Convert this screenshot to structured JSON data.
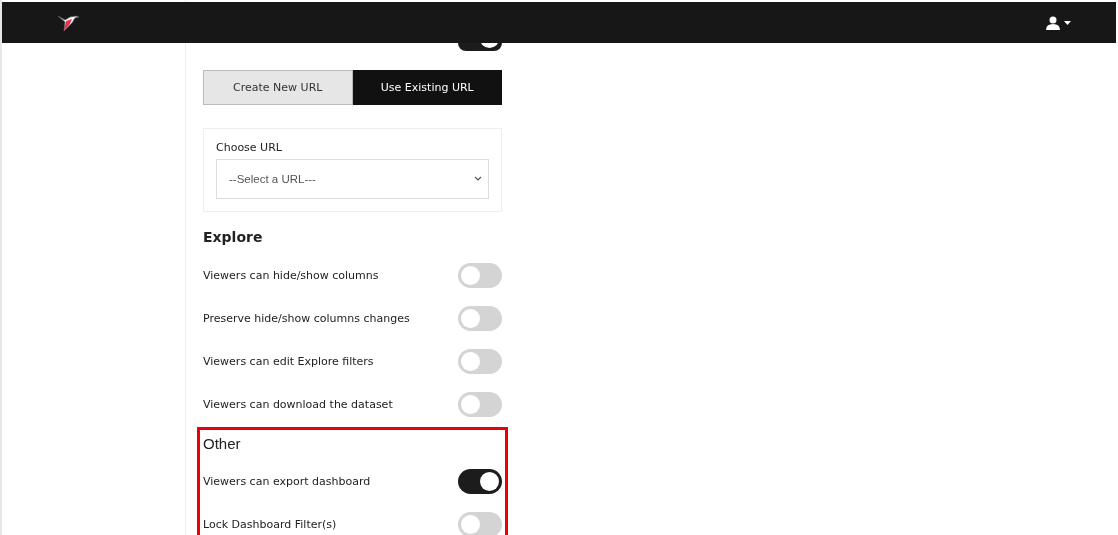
{
  "public_toggle": {
    "on": true
  },
  "url_tabs": [
    {
      "label": "Create New URL",
      "selected": false
    },
    {
      "label": "Use Existing URL",
      "selected": true
    }
  ],
  "url_card": {
    "label": "Choose URL",
    "select": {
      "placeholder": "--Select a URL---"
    }
  },
  "sections": [
    {
      "title": "Explore",
      "highlighted": false,
      "toggles": [
        {
          "label": "Viewers can hide/show columns",
          "on": false
        },
        {
          "label": "Preserve hide/show columns changes",
          "on": false
        },
        {
          "label": "Viewers can edit Explore filters",
          "on": false
        },
        {
          "label": "Viewers can download the dataset",
          "on": false
        }
      ]
    },
    {
      "title": "Other",
      "highlighted": true,
      "toggles": [
        {
          "label": "Viewers can export dashboard",
          "on": true
        },
        {
          "label": "Lock Dashboard Filter(s)",
          "on": false
        }
      ]
    }
  ]
}
